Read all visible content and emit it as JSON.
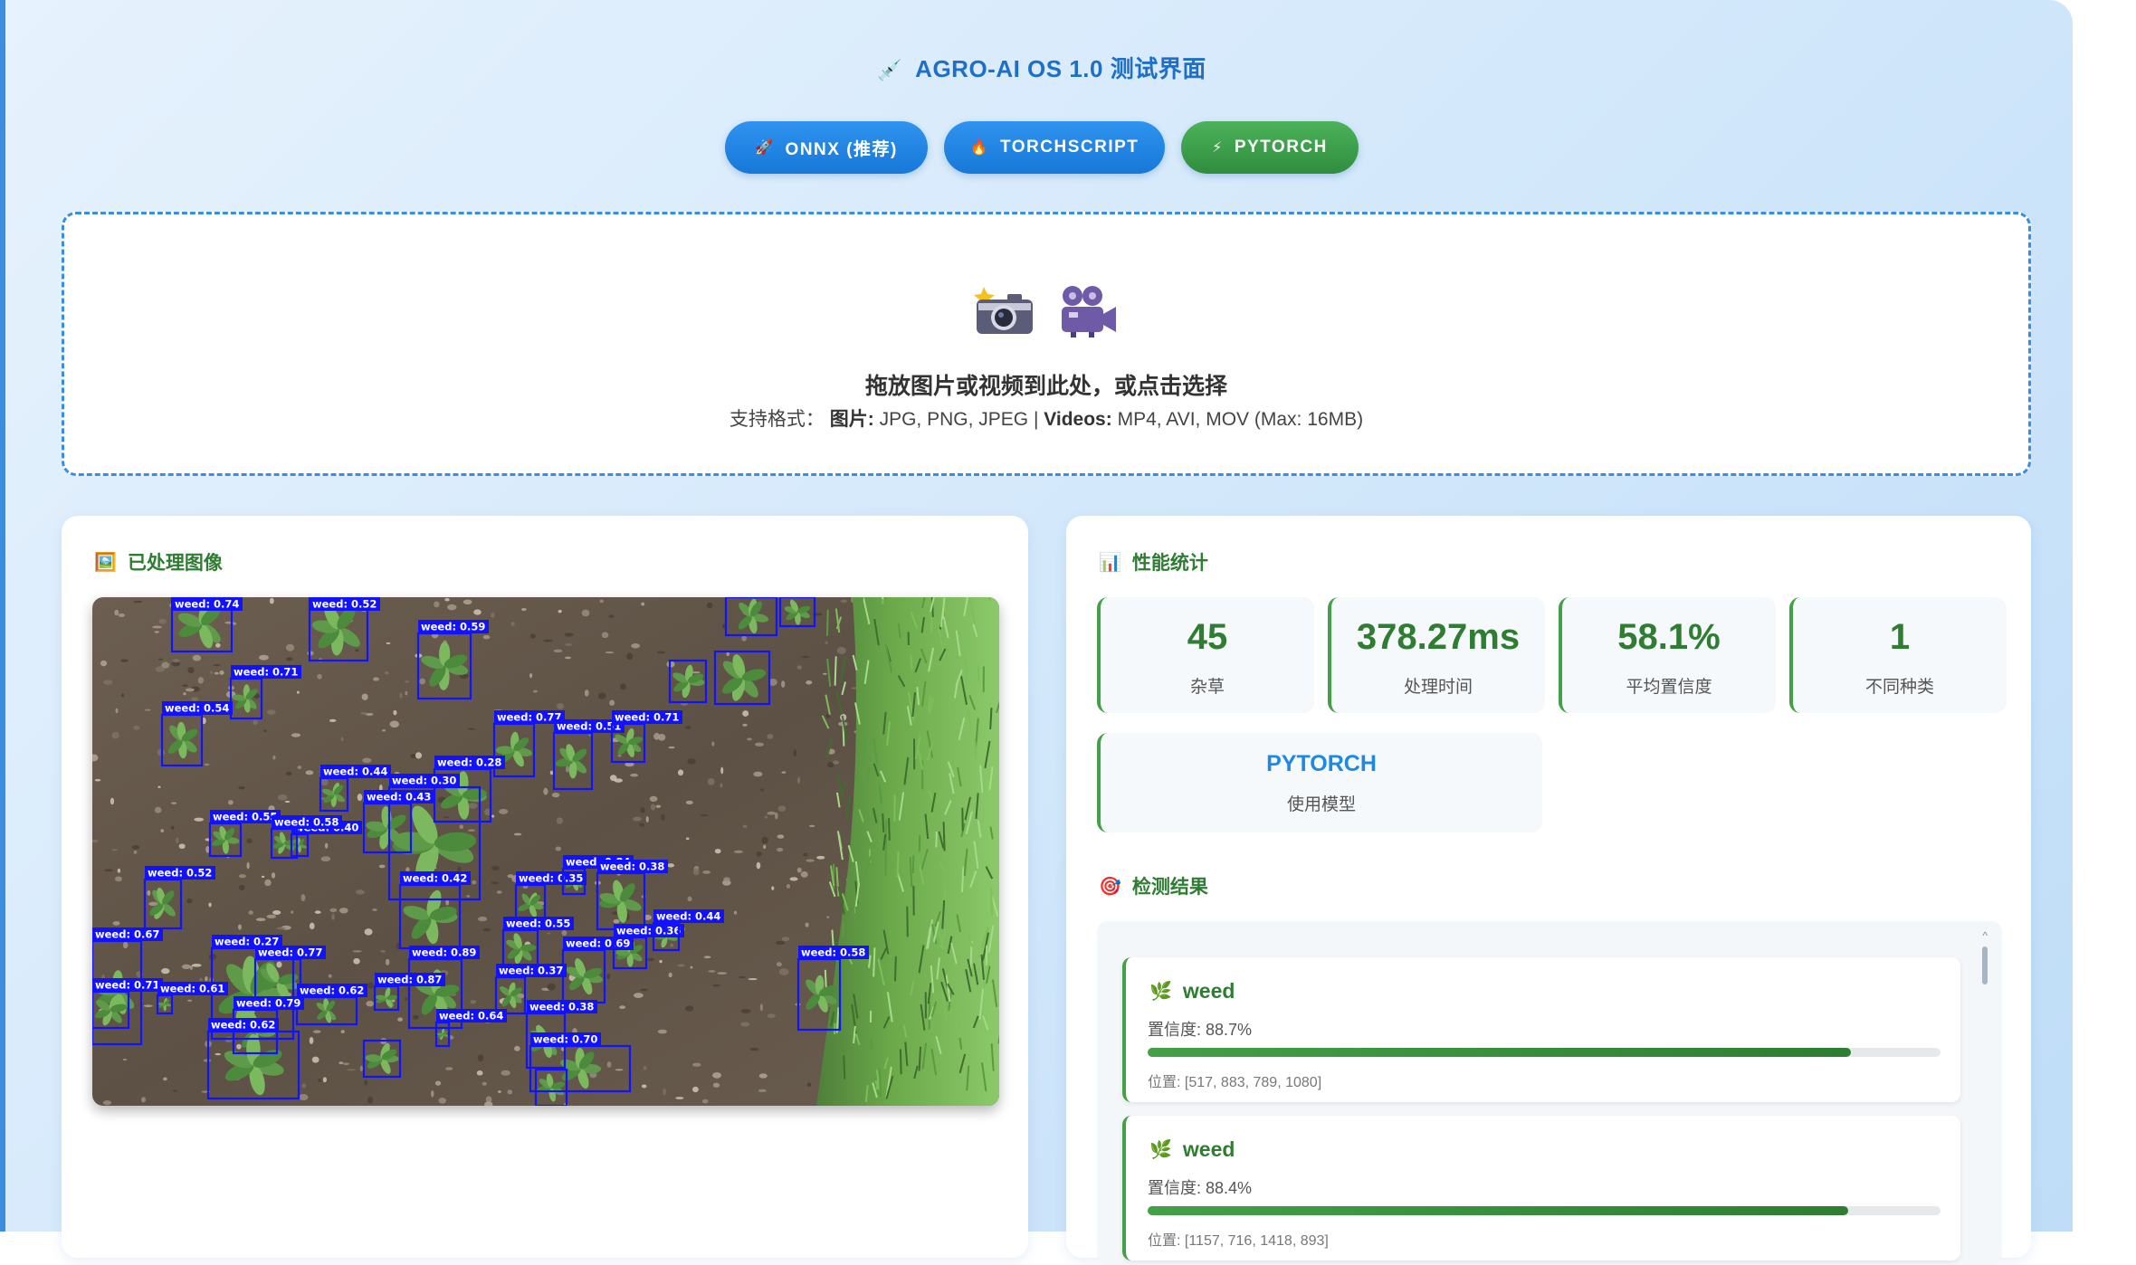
{
  "header": {
    "title": "AGRO-AI OS 1.0 测试界面",
    "title_icon": "syringe-icon"
  },
  "model_buttons": [
    {
      "label": "ONNX (推荐)",
      "icon": "rocket-icon",
      "color": "#1e88e5"
    },
    {
      "label": "TORCHSCRIPT",
      "icon": "fire-icon",
      "color": "#1e88e5"
    },
    {
      "label": "PYTORCH",
      "icon": "lightning-icon",
      "color": "#43a047"
    }
  ],
  "upload": {
    "icons": [
      "camera-flash-icon",
      "movie-camera-icon"
    ],
    "title": "拖放图片或视频到此处，或点击选择",
    "formats_prefix": "支持格式：",
    "images_label": "图片:",
    "images_formats": "JPG, PNG, JPEG |",
    "videos_label": "Videos:",
    "videos_formats": "MP4, AVI, MOV (Max: 16MB)"
  },
  "processed_image": {
    "title": "已处理图像",
    "icon": "framed-picture-icon",
    "detections": [
      {
        "label": "weed: 0.74"
      },
      {
        "label": "weed: 0.52"
      },
      {
        "label": "weed: 0.59"
      },
      {
        "label": "weed: 0.71"
      },
      {
        "label": "weed: 0.54"
      },
      {
        "label": "weed: 0.77"
      },
      {
        "label": "weed: 0.51"
      },
      {
        "label": "weed: 0.71"
      },
      {
        "label": "weed: 0.28"
      },
      {
        "label": "weed: 0.44"
      },
      {
        "label": "weed: 0.30"
      },
      {
        "label": "weed: 0.43"
      },
      {
        "label": "weed: 0.40"
      },
      {
        "label": "weed: 0.55"
      },
      {
        "label": "weed: 0.58"
      },
      {
        "label": "weed: 0.42"
      },
      {
        "label": "weed: 0.52"
      },
      {
        "label": "weed: 0.35"
      },
      {
        "label": "weed: 0.84"
      },
      {
        "label": "weed: 0.38"
      },
      {
        "label": "weed: 0.67"
      },
      {
        "label": "weed: 0.27"
      },
      {
        "label": "weed: 0.55"
      },
      {
        "label": "weed: 0.69"
      },
      {
        "label": "weed: 0.36"
      },
      {
        "label": "weed: 0.77"
      },
      {
        "label": "weed: 0.89"
      },
      {
        "label": "weed: 0.87"
      },
      {
        "label": "weed: 0.37"
      },
      {
        "label": "weed: 0.71"
      },
      {
        "label": "weed: 0.61"
      },
      {
        "label": "weed: 0.62"
      },
      {
        "label": "weed: 0.79"
      },
      {
        "label": "weed: 0.64"
      },
      {
        "label": "weed: 0.38"
      },
      {
        "label": "weed: 0.62"
      },
      {
        "label": "weed: 0.58"
      },
      {
        "label": "weed: 0.70"
      },
      {
        "label": "weed: 0.44"
      }
    ]
  },
  "stats": {
    "title": "性能统计",
    "icon": "bar-chart-icon",
    "items": [
      {
        "value": "45",
        "label": "杂草"
      },
      {
        "value": "378.27ms",
        "label": "处理时间"
      },
      {
        "value": "58.1%",
        "label": "平均置信度"
      },
      {
        "value": "1",
        "label": "不同种类"
      }
    ],
    "model": {
      "value": "PYTORCH",
      "label": "使用模型"
    }
  },
  "results": {
    "title": "检测结果",
    "icon": "target-icon",
    "items": [
      {
        "name": "weed",
        "icon": "herb-icon",
        "confidence_text": "置信度: 88.7%",
        "confidence": 0.887,
        "position": "位置: [517, 883, 789, 1080]"
      },
      {
        "name": "weed",
        "icon": "herb-icon",
        "confidence_text": "置信度: 88.4%",
        "confidence": 0.884,
        "position": "位置: [1157, 716, 1418, 893]"
      }
    ]
  }
}
